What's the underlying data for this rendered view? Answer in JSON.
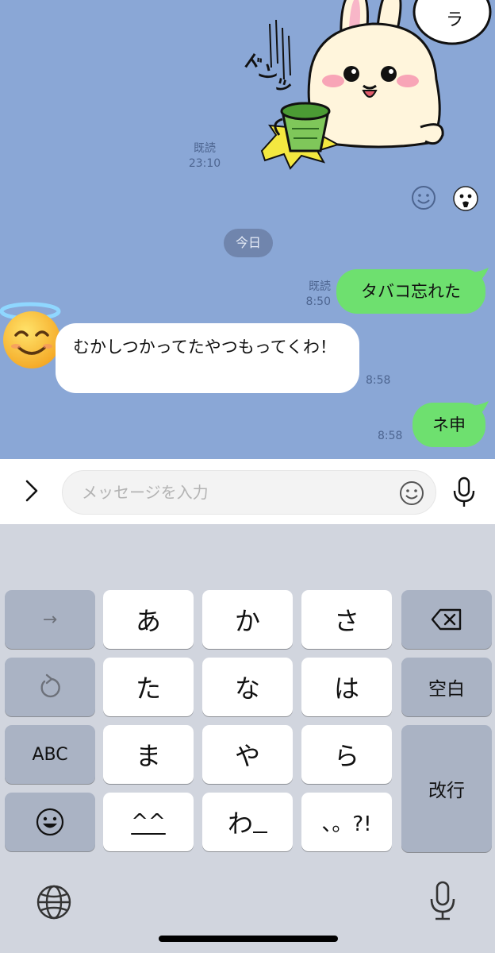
{
  "chat": {
    "background": "#8aa7d6",
    "sticker": {
      "text": "ドンッ",
      "speech": "ラ"
    },
    "read_old": {
      "status": "既読",
      "time": "23:10"
    },
    "date_divider": "今日",
    "messages": [
      {
        "direction": "out",
        "text": "タバコ忘れた",
        "status": "既読",
        "time": "8:50"
      },
      {
        "direction": "in",
        "text": "むかしつかってたやつもってくわ！",
        "time": "8:58"
      },
      {
        "direction": "out",
        "text": "ネ申",
        "time": "8:58"
      }
    ]
  },
  "input_bar": {
    "placeholder": "メッセージを入力"
  },
  "keyboard": {
    "row1": [
      "→",
      "あ",
      "か",
      "さ",
      "delete"
    ],
    "row2": [
      "undo",
      "た",
      "な",
      "は",
      "空白"
    ],
    "row3": [
      "ABC",
      "ま",
      "や",
      "ら",
      "改行"
    ],
    "row4": [
      "emoji",
      "^^",
      "わ",
      "、。?!"
    ],
    "labels": {
      "arrow": "→",
      "a": "あ",
      "ka": "か",
      "sa": "さ",
      "ta": "た",
      "na": "な",
      "ha": "は",
      "space": "空白",
      "abc": "ABC",
      "ma": "ま",
      "ya": "や",
      "ra": "ら",
      "enter": "改行",
      "kaomoji": "^^",
      "wa": "わ",
      "punct": "、。?!"
    }
  },
  "colors": {
    "out_bubble": "#6ee06f",
    "in_bubble": "#ffffff",
    "date_pill": "#7085ad",
    "key_white": "#ffffff",
    "key_gray": "#aab3c4"
  }
}
